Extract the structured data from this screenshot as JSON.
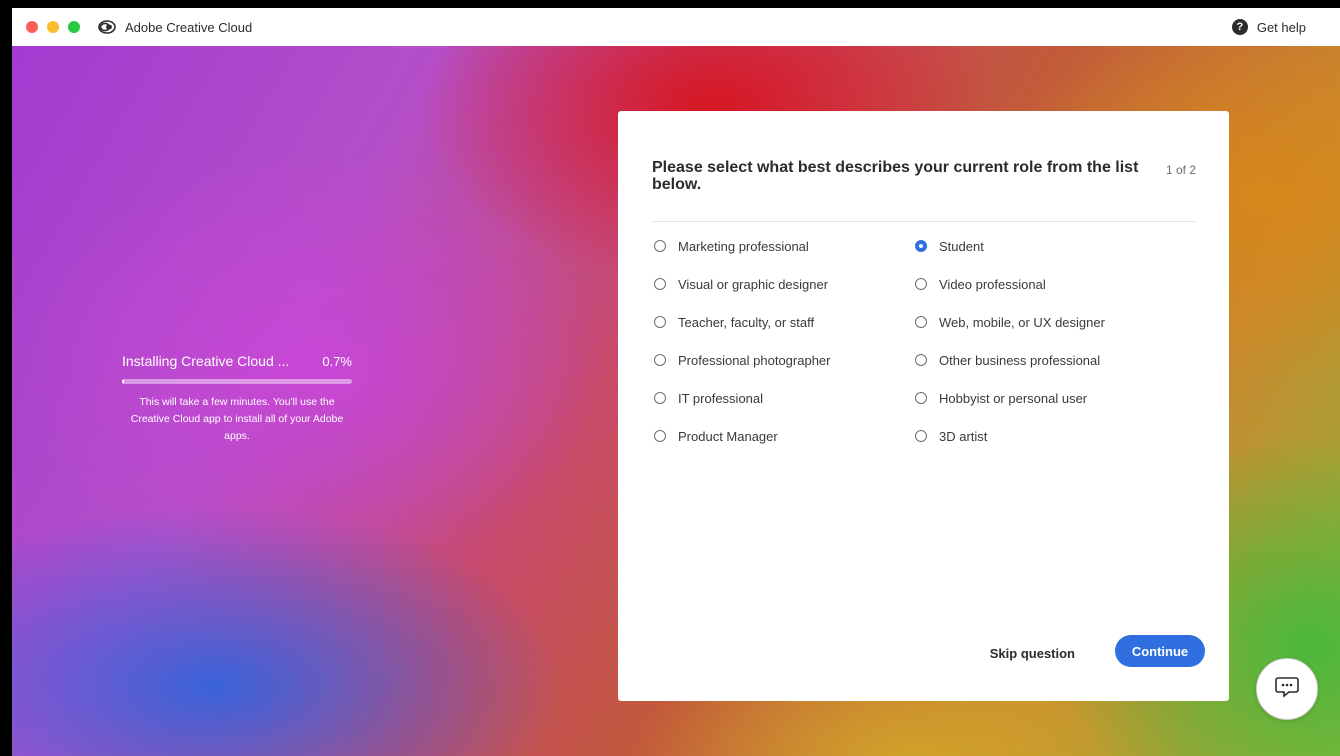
{
  "window": {
    "title": "Adobe Creative Cloud",
    "help_label": "Get help"
  },
  "install": {
    "title": "Installing Creative Cloud ...",
    "percent_label": "0.7%",
    "progress_fraction": 0.007,
    "description": "This will take a few minutes. You'll use the Creative Cloud app to install all of your Adobe apps."
  },
  "question": {
    "title": "Please select what best describes your current role from the list below.",
    "step": "1 of 2",
    "options": [
      {
        "label": "Marketing professional",
        "checked": false
      },
      {
        "label": "Student",
        "checked": true
      },
      {
        "label": "Visual or graphic designer",
        "checked": false
      },
      {
        "label": "Video professional",
        "checked": false
      },
      {
        "label": "Teacher, faculty, or staff",
        "checked": false
      },
      {
        "label": "Web, mobile, or UX designer",
        "checked": false
      },
      {
        "label": "Professional photographer",
        "checked": false
      },
      {
        "label": "Other business professional",
        "checked": false
      },
      {
        "label": "IT professional",
        "checked": false
      },
      {
        "label": "Hobbyist or personal user",
        "checked": false
      },
      {
        "label": "Product Manager",
        "checked": false
      },
      {
        "label": "3D artist",
        "checked": false
      }
    ],
    "skip_label": "Skip question",
    "continue_label": "Continue"
  },
  "colors": {
    "accent": "#2f6fe0"
  },
  "icons": {
    "app": "creative-cloud-logo-icon",
    "help": "question-circle-icon",
    "chat": "chat-bubble-icon"
  }
}
